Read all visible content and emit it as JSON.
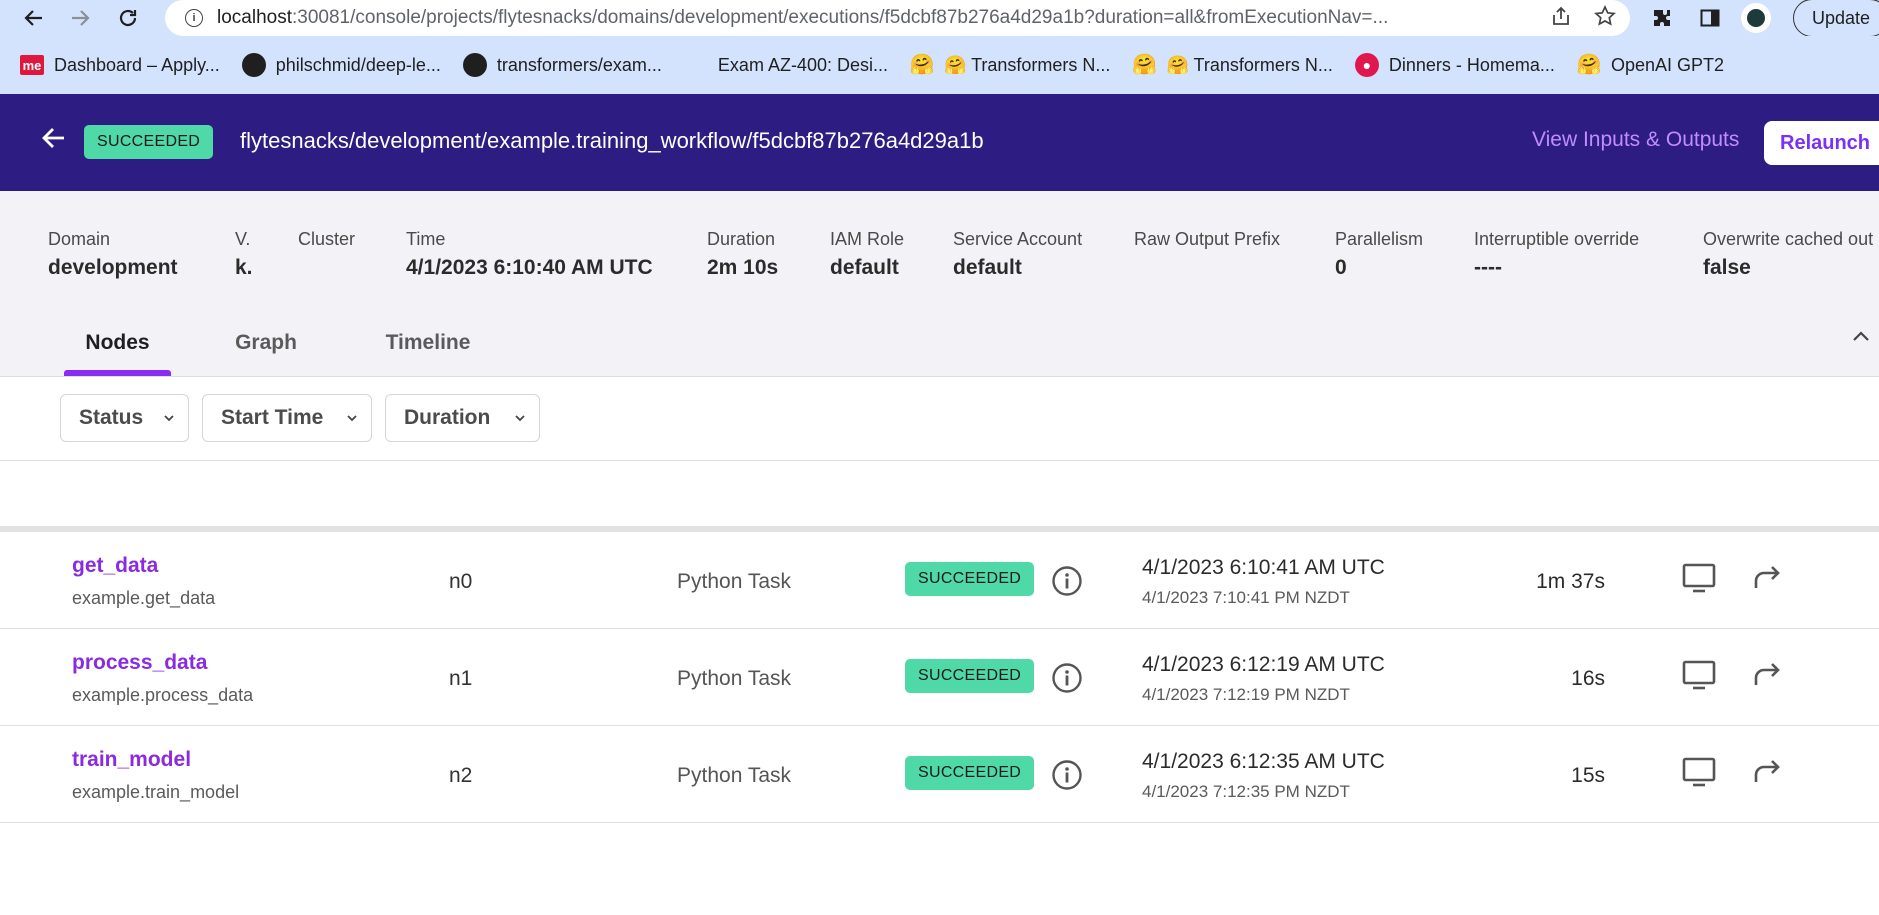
{
  "browser": {
    "url_host": "localhost",
    "url_rest": ":30081/console/projects/flytesnacks/domains/development/executions/f5dcbf87b276a4d29a1b?duration=all&fromExecutionNav=...",
    "update_label": "Update",
    "bookmarks": [
      {
        "label": "Dashboard – Apply...",
        "icon": "me-logo"
      },
      {
        "label": "philschmid/deep-le...",
        "icon": "github-icon"
      },
      {
        "label": "transformers/exam...",
        "icon": "github-icon"
      },
      {
        "label": "Exam AZ-400: Desi...",
        "icon": "microsoft-icon"
      },
      {
        "label": "🤗 Transformers N...",
        "icon": "huggingface-icon"
      },
      {
        "label": "🤗 Transformers N...",
        "icon": "huggingface-icon"
      },
      {
        "label": "Dinners - Homema...",
        "icon": "dinners-icon"
      },
      {
        "label": "OpenAI GPT2",
        "icon": "huggingface-icon"
      }
    ]
  },
  "header": {
    "status": "SUCCEEDED",
    "title": "flytesnacks/development/example.training_workflow/f5dcbf87b276a4d29a1b",
    "view_io_label": "View Inputs & Outputs",
    "relaunch_label": "Relaunch",
    "colors": {
      "bar": "#2d1c82",
      "badge": "#4ed9a6",
      "accent": "#8a2be2"
    }
  },
  "metadata": [
    {
      "label": "Domain",
      "value": "development"
    },
    {
      "label": "V.",
      "value": "k."
    },
    {
      "label": "Cluster",
      "value": ""
    },
    {
      "label": "Time",
      "value": "4/1/2023 6:10:40 AM UTC"
    },
    {
      "label": "Duration",
      "value": "2m 10s"
    },
    {
      "label": "IAM Role",
      "value": "default"
    },
    {
      "label": "Service Account",
      "value": "default"
    },
    {
      "label": "Raw Output Prefix",
      "value": ""
    },
    {
      "label": "Parallelism",
      "value": "0"
    },
    {
      "label": "Interruptible override",
      "value": "----"
    },
    {
      "label": "Overwrite cached out",
      "value": "false"
    }
  ],
  "tabs": [
    {
      "label": "Nodes",
      "active": true
    },
    {
      "label": "Graph",
      "active": false
    },
    {
      "label": "Timeline",
      "active": false
    }
  ],
  "filters": [
    {
      "label": "Status"
    },
    {
      "label": "Start Time"
    },
    {
      "label": "Duration"
    }
  ],
  "nodes": [
    {
      "name": "get_data",
      "task": "example.get_data",
      "id": "n0",
      "type": "Python Task",
      "status": "SUCCEEDED",
      "start_utc": "4/1/2023 6:10:41 AM UTC",
      "start_local": "4/1/2023 7:10:41 PM NZDT",
      "duration": "1m 37s"
    },
    {
      "name": "process_data",
      "task": "example.process_data",
      "id": "n1",
      "type": "Python Task",
      "status": "SUCCEEDED",
      "start_utc": "4/1/2023 6:12:19 AM UTC",
      "start_local": "4/1/2023 7:12:19 PM NZDT",
      "duration": "16s"
    },
    {
      "name": "train_model",
      "task": "example.train_model",
      "id": "n2",
      "type": "Python Task",
      "status": "SUCCEEDED",
      "start_utc": "4/1/2023 6:12:35 AM UTC",
      "start_local": "4/1/2023 7:12:35 PM NZDT",
      "duration": "15s"
    }
  ]
}
